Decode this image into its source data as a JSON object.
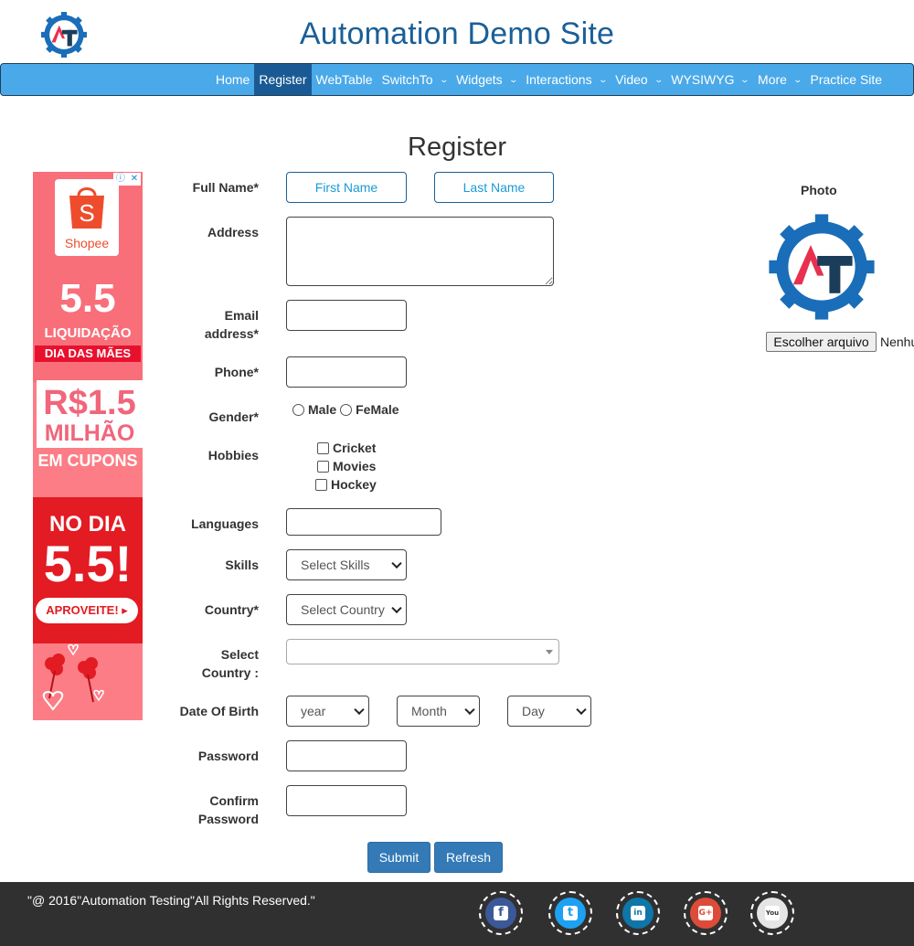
{
  "header": {
    "title": "Automation Demo Site"
  },
  "nav": {
    "items": [
      {
        "label": "Home",
        "dropdown": false,
        "active": false
      },
      {
        "label": "Register",
        "dropdown": false,
        "active": true
      },
      {
        "label": "WebTable",
        "dropdown": false,
        "active": false
      },
      {
        "label": "SwitchTo",
        "dropdown": true,
        "active": false
      },
      {
        "label": "Widgets",
        "dropdown": true,
        "active": false
      },
      {
        "label": "Interactions",
        "dropdown": true,
        "active": false
      },
      {
        "label": "Video",
        "dropdown": true,
        "active": false
      },
      {
        "label": "WYSIWYG",
        "dropdown": true,
        "active": false
      },
      {
        "label": "More",
        "dropdown": true,
        "active": false
      },
      {
        "label": "Practice Site",
        "dropdown": false,
        "active": false
      }
    ],
    "colors": {
      "bar": "#4aa9e9",
      "active": "#1a5a94"
    }
  },
  "page": {
    "title": "Register"
  },
  "ad": {
    "info_glyph": "ⓘ",
    "close_glyph": "✕",
    "brand": "Shopee",
    "bag_letter": "S",
    "headline": "5.5",
    "subhead": "LIQUIDAÇÃO",
    "ribbon": "DIA DAS MÃES",
    "coupon_amount": "R$1.5",
    "coupon_unit": "MILHÃO",
    "coupon_text": "EM CUPONS",
    "day_text": "NO DIA",
    "day_number": "5.5!",
    "cta": "APROVEITE! ▸"
  },
  "form": {
    "labels": {
      "full_name": "Full Name*",
      "address": "Address",
      "email_line1": "Email",
      "email_line2": "address*",
      "phone": "Phone*",
      "gender": "Gender*",
      "hobbies": "Hobbies",
      "languages": "Languages",
      "skills": "Skills",
      "country": "Country*",
      "select_country_line1": "Select",
      "select_country_line2": "Country :",
      "dob": "Date Of Birth",
      "password": "Password",
      "confirm_line1": "Confirm",
      "confirm_line2": "Password"
    },
    "placeholders": {
      "first_name": "First Name",
      "last_name": "Last Name"
    },
    "values": {
      "first_name": "",
      "last_name": "",
      "address": "",
      "email": "",
      "phone": "",
      "password": "",
      "confirm_password": ""
    },
    "gender_options": [
      "Male",
      "FeMale"
    ],
    "hobbies": [
      "Cricket",
      "Movies",
      "Hockey"
    ],
    "selects": {
      "skills": "Select Skills",
      "country": "Select Country",
      "year": "year",
      "month": "Month",
      "day": "Day"
    },
    "buttons": {
      "submit": "Submit",
      "refresh": "Refresh"
    }
  },
  "photo": {
    "label": "Photo",
    "file_button": "Escolher arquivo",
    "file_status": "Nenhum arquivo selecionado"
  },
  "footer": {
    "copyright": "\"@ 2016\"Automation Testing\"All Rights Reserved.\"",
    "social": [
      {
        "icon": "facebook-icon",
        "glyph": "f",
        "color": "#3b5998"
      },
      {
        "icon": "twitter-icon",
        "glyph": "t",
        "color": "#1da1f2"
      },
      {
        "icon": "linkedin-icon",
        "glyph": "in",
        "color": "#0e76a8"
      },
      {
        "icon": "google-plus-icon",
        "glyph": "G+",
        "color": "#dd4b39"
      },
      {
        "icon": "youtube-icon",
        "glyph": "You",
        "color": "#e5e5e5"
      }
    ]
  }
}
